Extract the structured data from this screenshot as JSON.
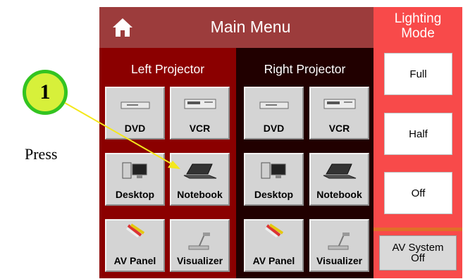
{
  "annotation": {
    "step_number": "1",
    "instruction": "Press"
  },
  "header": {
    "title": "Main Menu"
  },
  "left_projector": {
    "title": "Left Projector",
    "buttons": [
      "DVD",
      "VCR",
      "Desktop",
      "Notebook",
      "AV Panel",
      "Visualizer"
    ]
  },
  "right_projector": {
    "title": "Right Projector",
    "buttons": [
      "DVD",
      "VCR",
      "Desktop",
      "Notebook",
      "AV Panel",
      "Visualizer"
    ]
  },
  "lighting": {
    "title_line1": "Lighting",
    "title_line2": "Mode",
    "buttons": [
      "Full",
      "Half",
      "Off"
    ]
  },
  "system": {
    "line1": "AV System",
    "line2": "Off"
  },
  "colors": {
    "header": "#9c3c3c",
    "left_bg": "#8b0000",
    "right_bg": "#210000",
    "side_bg": "#f84a4a",
    "callout_fill": "#d7f03a",
    "callout_ring": "#33c421",
    "arrow": "#f4e81c"
  },
  "icons": [
    "home-icon",
    "dvd-player-icon",
    "vcr-icon",
    "desktop-computer-icon",
    "notebook-laptop-icon",
    "av-cable-icon",
    "visualizer-camera-icon"
  ]
}
